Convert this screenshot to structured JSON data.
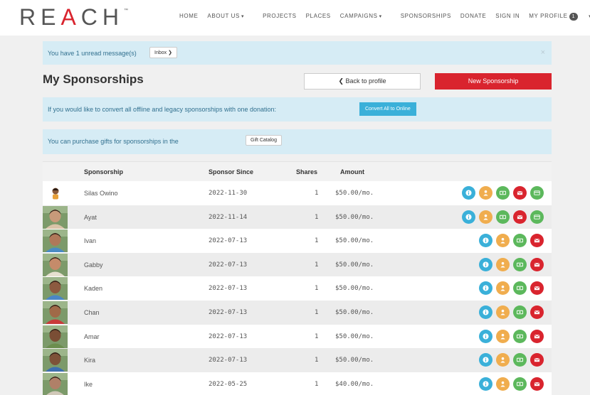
{
  "brand": {
    "logo_r": "RE",
    "logo_a": "A",
    "logo_rest": "CH",
    "tm": "™"
  },
  "nav": [
    {
      "label": "HOME",
      "caret": false
    },
    {
      "label": "ABOUT US",
      "caret": true
    },
    {
      "label": "PROJECTS",
      "caret": false
    },
    {
      "label": "PLACES",
      "caret": false
    },
    {
      "label": "CAMPAIGNS",
      "caret": true
    },
    {
      "label": "SPONSORSHIPS",
      "caret": false
    },
    {
      "label": "DONATE",
      "caret": false
    },
    {
      "label": "SIGN IN",
      "caret": false
    },
    {
      "label": "MY PROFILE",
      "caret": true,
      "badge": "1"
    }
  ],
  "inbox_alert": {
    "text": "You have 1 unread message(s)",
    "button": "Inbox ❯",
    "close": "×"
  },
  "page_title": "My Sponsorships",
  "buttons": {
    "back": "❮ Back to profile",
    "new": "New Sponsorship"
  },
  "convert_alert": {
    "text": "If you would like to convert all offline and legacy sponsorships with one donation:",
    "button": "Convert All to Online"
  },
  "gift_alert": {
    "text": "You can purchase gifts for sponsorships in the",
    "button": "Gift Catalog"
  },
  "table": {
    "headers": {
      "sponsorship": "Sponsorship",
      "since": "Sponsor Since",
      "shares": "Shares",
      "amount": "Amount"
    },
    "rows": [
      {
        "name": "Silas Owino",
        "since": "2022-11-30",
        "shares": "1",
        "amount": "$50.00/mo.",
        "card": true,
        "photo": "small",
        "skin": "#8a5a3b",
        "shirt": "#e8a13a"
      },
      {
        "name": "Ayat",
        "since": "2022-11-14",
        "shares": "1",
        "amount": "$50.00/mo.",
        "card": true,
        "photo": "full",
        "skin": "#c89a7a",
        "shirt": "#d9c3a8"
      },
      {
        "name": "Ivan",
        "since": "2022-07-13",
        "shares": "1",
        "amount": "$50.00/mo.",
        "card": false,
        "photo": "full",
        "skin": "#b0785a",
        "shirt": "#4a8bc4"
      },
      {
        "name": "Gabby",
        "since": "2022-07-13",
        "shares": "1",
        "amount": "$50.00/mo.",
        "card": false,
        "photo": "full",
        "skin": "#c58b6a",
        "shirt": "#e6e0d0"
      },
      {
        "name": "Kaden",
        "since": "2022-07-13",
        "shares": "1",
        "amount": "$50.00/mo.",
        "card": false,
        "photo": "full",
        "skin": "#8c5a40",
        "shirt": "#4a86c6"
      },
      {
        "name": "Chan",
        "since": "2022-07-13",
        "shares": "1",
        "amount": "$50.00/mo.",
        "card": false,
        "photo": "full",
        "skin": "#a06a48",
        "shirt": "#c93a3a"
      },
      {
        "name": "Amar",
        "since": "2022-07-13",
        "shares": "1",
        "amount": "$50.00/mo.",
        "card": false,
        "photo": "full",
        "skin": "#7a4e35",
        "shirt": "#6b8e4e"
      },
      {
        "name": "Kira",
        "since": "2022-07-13",
        "shares": "1",
        "amount": "$50.00/mo.",
        "card": false,
        "photo": "full",
        "skin": "#7d5238",
        "shirt": "#3d6fb0"
      },
      {
        "name": "Ike",
        "since": "2022-05-25",
        "shares": "1",
        "amount": "$40.00/mo.",
        "card": false,
        "photo": "full",
        "skin": "#b08068",
        "shirt": "#d0c8b8"
      }
    ]
  }
}
